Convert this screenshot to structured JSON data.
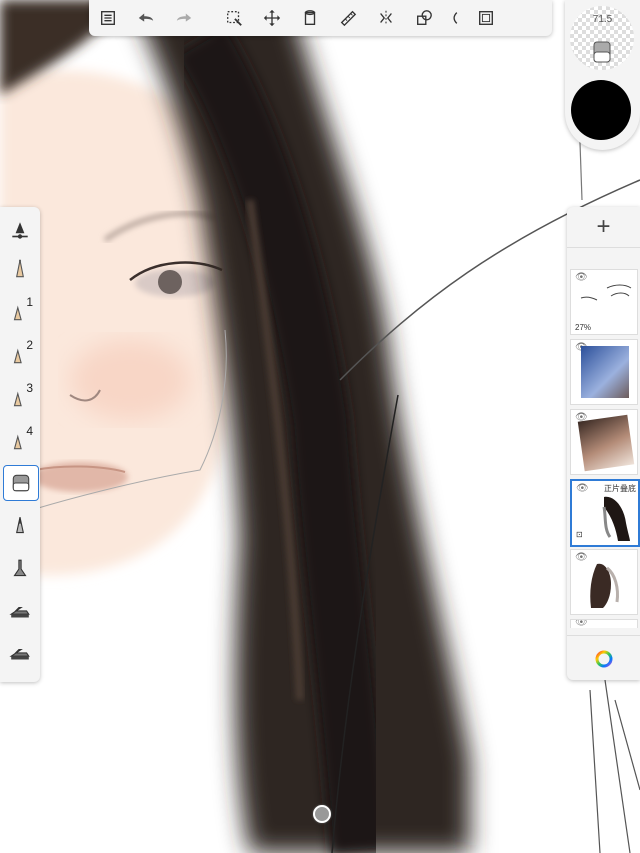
{
  "toolbar": {
    "items": [
      "layers-list-icon",
      "undo-icon",
      "redo-icon",
      "select-icon",
      "transform-icon",
      "fill-icon",
      "ruler-icon",
      "symmetry-icon",
      "shapes-icon",
      "perspective-icon",
      "fullscreen-icon"
    ]
  },
  "brushes": [
    {
      "name": "brush-settings",
      "number": ""
    },
    {
      "name": "pencil",
      "number": ""
    },
    {
      "name": "pencil",
      "number": "1"
    },
    {
      "name": "pencil",
      "number": "2"
    },
    {
      "name": "pencil",
      "number": "3"
    },
    {
      "name": "pencil",
      "number": "4"
    },
    {
      "name": "eraser",
      "number": ""
    },
    {
      "name": "pen",
      "number": ""
    },
    {
      "name": "airbrush",
      "number": ""
    },
    {
      "name": "marker",
      "number": ""
    },
    {
      "name": "marker",
      "number": ""
    }
  ],
  "brush_size": "71.5",
  "current_color": "#000000",
  "layers": [
    {
      "opacity_text": "27%",
      "blend_text": ""
    },
    {
      "opacity_text": "",
      "blend_text": ""
    },
    {
      "opacity_text": "",
      "blend_text": ""
    },
    {
      "opacity_text": "",
      "blend_text": "正片叠底"
    },
    {
      "opacity_text": "",
      "blend_text": ""
    }
  ],
  "add_layer_label": "+",
  "colors": {
    "accent": "#2f7bd6",
    "panel": "#f4f4f4"
  }
}
